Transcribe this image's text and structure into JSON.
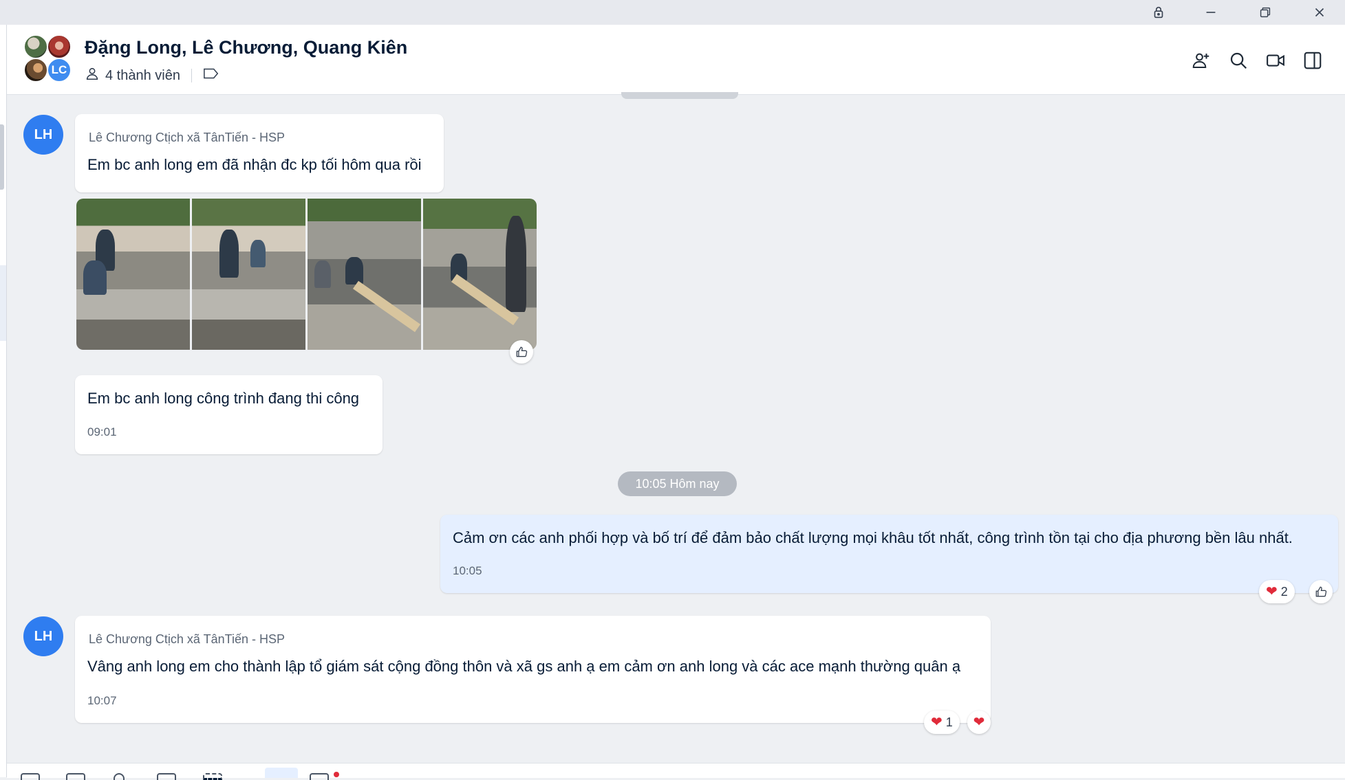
{
  "window": {
    "controls": [
      "lock-icon",
      "minimize-icon",
      "restore-icon",
      "close-icon"
    ]
  },
  "header": {
    "title": "Đặng Long, Lê Chương, Quang Kiên",
    "avatar_initials": "LC",
    "members_label": "4 thành viên",
    "actions": [
      "add-member-icon",
      "search-icon",
      "video-call-icon",
      "toggle-panel-icon"
    ]
  },
  "messages": [
    {
      "avatar": "LH",
      "sender": "Lê Chương Ctịch xã TânTiến - HSP",
      "text": "Em bc anh long em đã nhận đc kp tối hôm qua rồi"
    },
    {
      "type": "photos",
      "count": 4
    },
    {
      "text": "Em bc anh long công trình đang thi công",
      "time": "09:01"
    },
    {
      "type": "time-divider",
      "text": "10:05 Hôm nay"
    },
    {
      "mine": true,
      "text": "Cảm ơn các anh phối hợp và bố trí để đảm bảo chất lượng mọi khâu tốt nhất, công trình tồn tại cho địa phương bền lâu nhất.",
      "time": "10:05",
      "reaction_count": "2"
    },
    {
      "avatar": "LH",
      "sender": "Lê Chương Ctịch xã TânTiến - HSP",
      "text": "Vâng anh long em cho thành lập tổ giám sát cộng đồng thôn và xã gs anh ạ em cảm ơn anh long và các ace mạnh thường quân ạ",
      "time": "10:07",
      "reaction_count": "1"
    }
  ],
  "colors": {
    "accent": "#2f7df0",
    "my_bubble": "#e5efff",
    "heart": "#e02b3a"
  }
}
